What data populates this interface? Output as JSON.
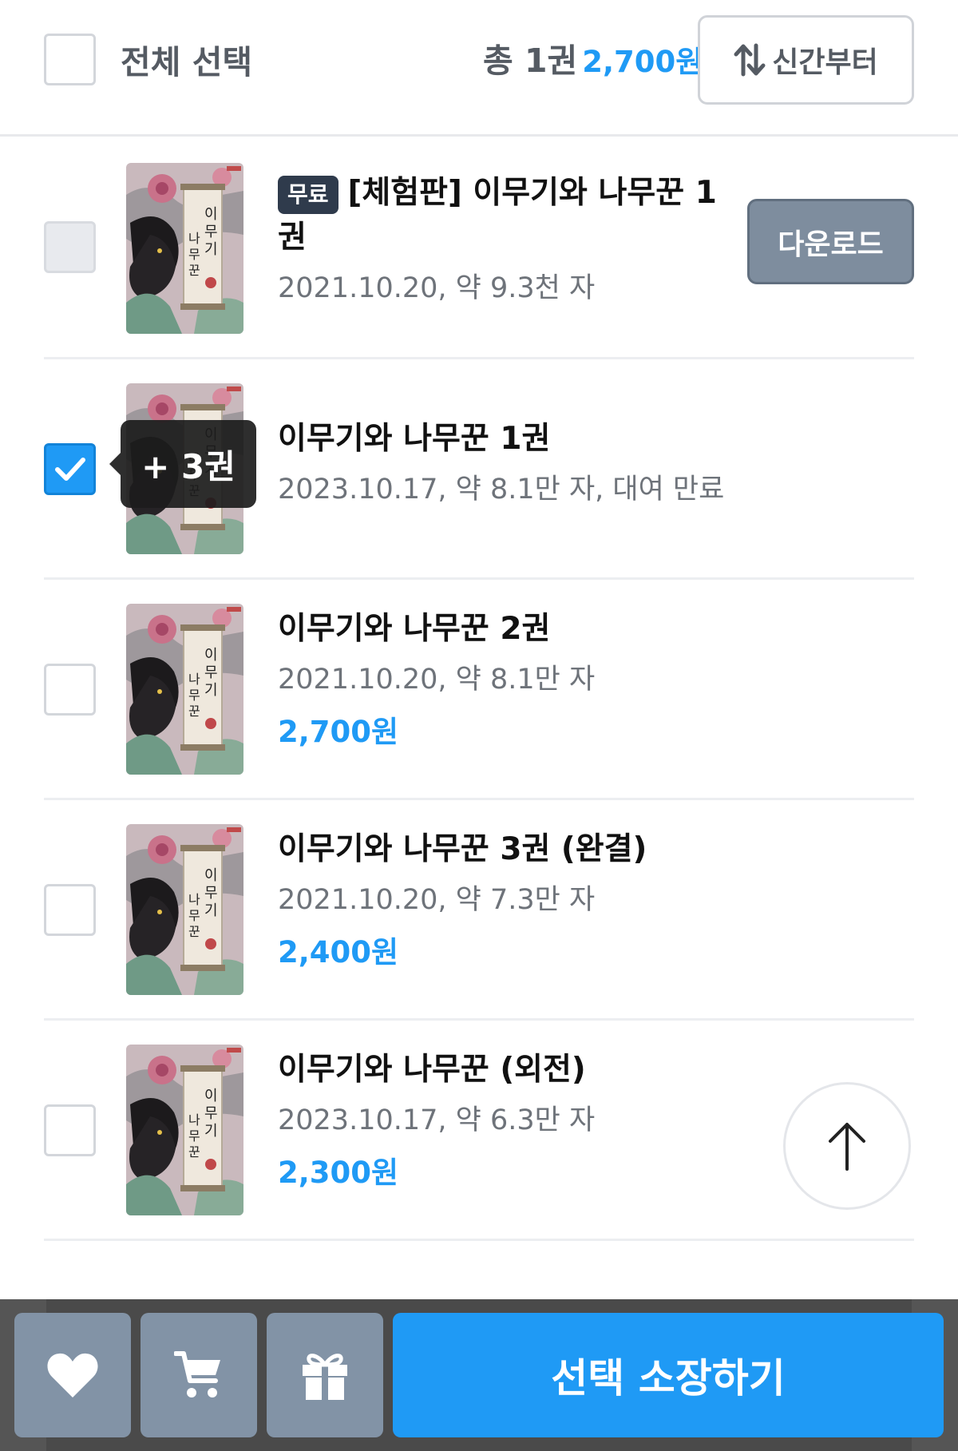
{
  "header": {
    "select_all_label": "전체 선택",
    "total_count": "총 1권",
    "total_price": "2,700원",
    "sort_label": "신간부터"
  },
  "books": [
    {
      "badge": "무료",
      "title": "[체험판] 이무기와 나무꾼 1권",
      "meta": "2021.10.20, 약 9.3천 자",
      "action_label": "다운로드",
      "checked": false,
      "disabled": true
    },
    {
      "title": "이무기와 나무꾼 1권",
      "meta": "2023.10.17, 약 8.1만 자, 대여 만료",
      "tooltip": "+ 3권",
      "checked": true
    },
    {
      "title": "이무기와 나무꾼 2권",
      "meta": "2021.10.20, 약 8.1만 자",
      "price": "2,700원",
      "checked": false
    },
    {
      "title": "이무기와 나무꾼 3권 (완결)",
      "meta": "2021.10.20, 약 7.3만 자",
      "price": "2,400원",
      "checked": false
    },
    {
      "title": "이무기와 나무꾼 (외전)",
      "meta": "2023.10.17, 약 6.3만 자",
      "price": "2,300원",
      "checked": false
    }
  ],
  "bottom_bar": {
    "wishlist_icon": "heart-icon",
    "cart_icon": "cart-icon",
    "gift_icon": "gift-icon",
    "buy_label": "선택 소장하기"
  },
  "colors": {
    "accent": "#1f9af5",
    "icon_button": "#8293a6",
    "free_badge": "#2f3b4c"
  }
}
